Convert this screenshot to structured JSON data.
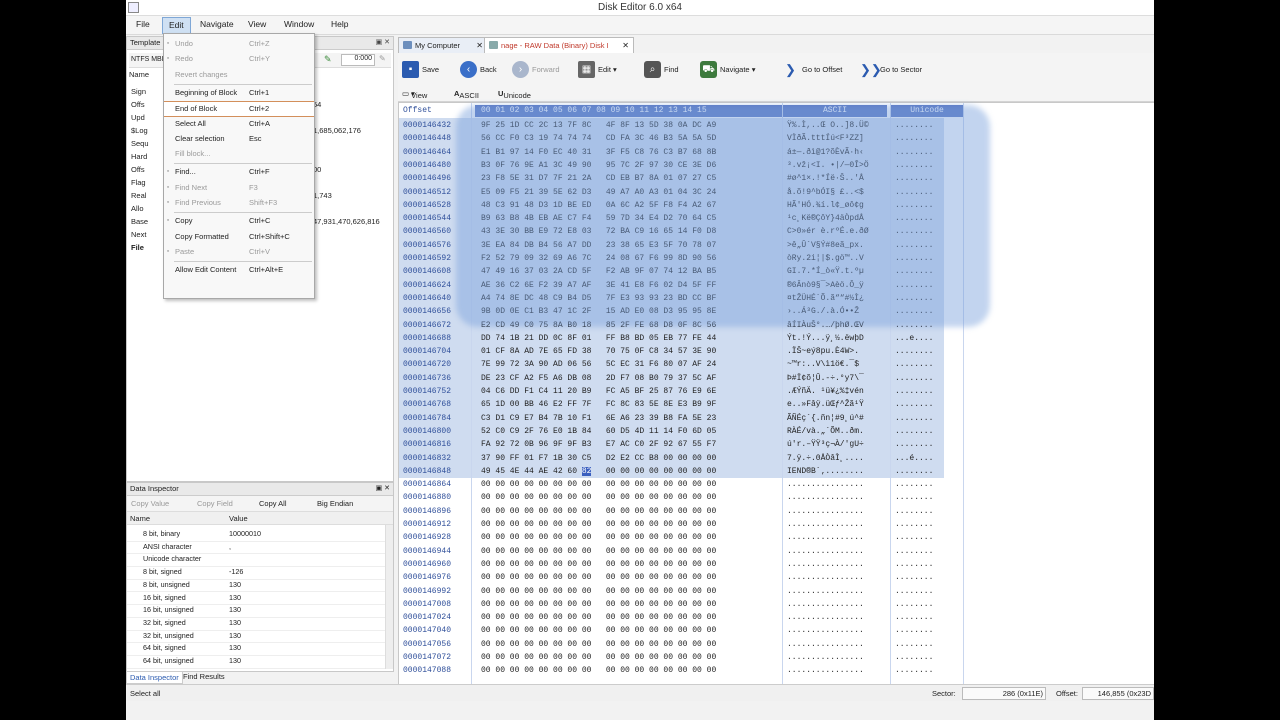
{
  "window": {
    "title": "Disk Editor 6.0 x64"
  },
  "menu": [
    "File",
    "Edit",
    "Navigate",
    "View",
    "Window",
    "Help"
  ],
  "template_panel": {
    "title": "Template",
    "selector": "NTFS MBR",
    "tool_value": "0:000",
    "column_header": "Name",
    "rows": [
      "Sign",
      "Offs",
      "Upd",
      "$Log",
      "Sequ",
      "Hard",
      "Offs",
      "Flag",
      "Real",
      "Allo",
      "Base",
      "Next",
      "File"
    ],
    "values": [
      "54",
      "1,685,062,176",
      "00",
      "1,743",
      "47,931,470,626,816"
    ]
  },
  "edit_menu": [
    {
      "label": "Undo",
      "shortcut": "Ctrl+Z",
      "disabled": true,
      "icon": "undo-icon"
    },
    {
      "label": "Redo",
      "shortcut": "Ctrl+Y",
      "disabled": true,
      "icon": "redo-icon"
    },
    {
      "label": "Revert changes",
      "shortcut": "",
      "disabled": true
    },
    {
      "sep": true
    },
    {
      "label": "Beginning of Block",
      "shortcut": "Ctrl+1",
      "disabled": false
    },
    {
      "label": "End of Block",
      "shortcut": "Ctrl+2",
      "disabled": false,
      "highlight": true
    },
    {
      "label": "Select All",
      "shortcut": "Ctrl+A",
      "disabled": false
    },
    {
      "label": "Clear selection",
      "shortcut": "Esc",
      "disabled": false
    },
    {
      "label": "Fill block...",
      "shortcut": "",
      "disabled": true
    },
    {
      "sep": true
    },
    {
      "label": "Find...",
      "shortcut": "Ctrl+F",
      "disabled": false,
      "icon": "find-icon"
    },
    {
      "label": "Find Next",
      "shortcut": "F3",
      "disabled": true,
      "icon": "find-next-icon"
    },
    {
      "label": "Find Previous",
      "shortcut": "Shift+F3",
      "disabled": true,
      "icon": "find-previous-icon"
    },
    {
      "sep": true
    },
    {
      "label": "Copy",
      "shortcut": "Ctrl+C",
      "disabled": false,
      "icon": "copy-icon"
    },
    {
      "label": "Copy Formatted",
      "shortcut": "Ctrl+Shift+C",
      "disabled": false
    },
    {
      "label": "Paste",
      "shortcut": "Ctrl+V",
      "disabled": true,
      "icon": "paste-icon"
    },
    {
      "sep": true
    },
    {
      "label": "Allow Edit Content",
      "shortcut": "Ctrl+Alt+E",
      "disabled": false
    }
  ],
  "tabs": [
    {
      "label": "My Computer",
      "active": false
    },
    {
      "label": "nage - RAW Data (Binary) Disk I",
      "active": true
    }
  ],
  "toolbar": [
    {
      "label": "Save",
      "icon": "save-icon",
      "color": "#2b5bb0",
      "disabled": false
    },
    {
      "label": "Back",
      "icon": "back-arrow-icon",
      "color": "#3a6fc8",
      "disabled": false
    },
    {
      "label": "Forward",
      "icon": "forward-arrow-icon",
      "color": "#a9b6cc",
      "disabled": true
    },
    {
      "label": "Edit",
      "icon": "edit-icon",
      "color": "#555555",
      "disabled": false
    },
    {
      "label": "Find",
      "icon": "find-binoculars-icon",
      "color": "#555555",
      "disabled": false
    },
    {
      "label": "Navigate",
      "icon": "navigate-icon",
      "color": "#3d7a3d",
      "disabled": false
    },
    {
      "label": "Go to Offset",
      "icon": "goto-offset-icon",
      "color": "#2b5bb0",
      "disabled": false
    },
    {
      "label": "Go to Sector",
      "icon": "goto-sector-icon",
      "color": "#2b5bb0",
      "disabled": false
    }
  ],
  "viewbar": {
    "view": "View",
    "ascii": "ASCII",
    "unicode": "Unicode"
  },
  "hex": {
    "header_offset": "Offset",
    "header_bytes": "00 01 02 03 04 05 06 07   08 09 10 11 12 13 14 15",
    "header_ascii": "ASCII",
    "header_unicode": "Unicode",
    "rows": [
      {
        "off": "0000146432",
        "b": "9F 25 1D CC 2C 13 7F 8C   4F 8F 13 5D 38 0A DC A9",
        "a": "Ÿ%.Ì,..Œ O..]8.Ü©",
        "u": "........"
      },
      {
        "off": "0000146448",
        "b": "56 CC F0 C3 19 74 74 74   CD FA 3C 46 B3 5A 5A 5D",
        "a": "VÌðÃ.tttÍú<F³ZZ]",
        "u": "........"
      },
      {
        "off": "0000146464",
        "b": "E1 B1 97 14 F0 EC 40 31   3F F5 C8 76 C3 B7 68 8B",
        "a": "á±—.ðì@1?õÈvÃ·h‹",
        "u": "........"
      },
      {
        "off": "0000146480",
        "b": "B3 0F 76 9E A1 3C 49 90   95 7C 2F 97 30 CE 3E D6",
        "a": "³.vž¡<I. •|/—0Î>Ö",
        "u": "........"
      },
      {
        "off": "0000146496",
        "b": "23 F8 5E 31 D7 7F 21 2A   CD EB B7 8A 01 07 27 C5",
        "a": "#ø^1×.!*Íë·Š..'Å",
        "u": "........"
      },
      {
        "off": "0000146512",
        "b": "E5 09 F5 21 39 5E 62 D3   49 A7 A0 A3 01 04 3C 24",
        "a": "å.õ!9^bÓI§ £..<$",
        "u": "........"
      },
      {
        "off": "0000146528",
        "b": "48 C3 91 48 D3 1D BE ED   0A 6C A2 5F F8 F4 A2 67",
        "a": "HÃ'HÓ.¾í.l¢_øô¢g",
        "u": "........"
      },
      {
        "off": "0000146544",
        "b": "B9 63 B8 4B EB AE C7 F4   59 7D 34 E4 D2 70 64 C5",
        "a": "¹c¸Kë®ÇôY}4äÒpdÅ",
        "u": "........"
      },
      {
        "off": "0000146560",
        "b": "43 3E 30 BB E9 72 E8 03   72 BA C9 16 65 14 F0 D8",
        "a": "C>0»ér è.rºÉ.e.ðØ",
        "u": "........"
      },
      {
        "off": "0000146576",
        "b": "3E EA 84 DB B4 56 A7 DD   23 38 65 E3 5F 70 78 07",
        "a": ">ê„Û´V§Ý#8eã_px.",
        "u": "........"
      },
      {
        "off": "0000146592",
        "b": "F2 52 79 09 32 69 A6 7C   24 08 67 F6 99 8D 90 56",
        "a": "òRy.2i¦|$.gö™..V",
        "u": "........"
      },
      {
        "off": "0000146608",
        "b": "47 49 16 37 03 2A CD 5F   F2 AB 9F 07 74 12 BA B5",
        "a": "GI.7.*Í_ò«Ÿ.t.ºµ",
        "u": "........"
      },
      {
        "off": "0000146624",
        "b": "AE 36 C2 6E F2 39 A7 AF   3E 41 E8 F6 02 D4 5F FF",
        "a": "®6Ânò9§¯>Aèö.Ô_ÿ",
        "u": "........"
      },
      {
        "off": "0000146640",
        "b": "A4 74 8E DC 48 C9 B4 D5   7F E3 93 93 23 BD CC BF",
        "a": "¤tŽÜHÉ´Õ.ã““#½Ì¿",
        "u": "........"
      },
      {
        "off": "0000146656",
        "b": "9B 0D 0E C1 B3 47 1C 2F   15 AD E0 08 D3 95 95 8E",
        "a": "›..Á³G./.­à.Ó••Ž",
        "u": "........"
      },
      {
        "off": "0000146672",
        "b": "E2 CD 49 C0 75 8A B0 18   85 2F FE 68 D8 0F 8C 56",
        "a": "âÍIÀuŠ°.…/þhØ.ŒV",
        "u": "........"
      },
      {
        "off": "0000146688",
        "b": "DD 74 1B 21 DD 0C 8F 01   FF B8 BD 05 EB 77 FE 44",
        "a": "Ýt.!Ý...ÿ¸½.ëwþD",
        "u": "...e...."
      },
      {
        "off": "0000146704",
        "b": "01 CF 8A AD 7E 65 FD 38   70 75 0F C8 34 57 3E 90",
        "a": ".ÏŠ­~eý8pu.È4W>.",
        "u": "........"
      },
      {
        "off": "0000146720",
        "b": "7E 99 72 3A 90 AD 06 56   5C EC 31 F6 80 07 AF 24",
        "a": "~™r:.­.V\\ì1ö€.¯$",
        "u": "........"
      },
      {
        "off": "0000146736",
        "b": "DE 23 CF A2 F5 A6 DB 08   2D F7 08 B0 79 37 5C AF",
        "a": "Þ#Ï¢õ¦Û.-÷.°y7\\¯",
        "u": "........"
      },
      {
        "off": "0000146752",
        "b": "04 C6 DD F1 C4 11 20 B9   FC A5 BF 25 87 76 E9 6E",
        "a": ".ÆÝñÄ. ¹ü¥¿%‡vén",
        "u": "........"
      },
      {
        "off": "0000146768",
        "b": "65 1D 00 BB 46 E2 FF 7F   FC 8C 83 5E 8E E3 B9 9F",
        "a": "e..»Fâÿ.üŒƒ^Žã¹Ÿ",
        "u": "........"
      },
      {
        "off": "0000146784",
        "b": "C3 D1 C9 E7 B4 7B 10 F1   6E A6 23 39 B8 FA 5E 23",
        "a": "ÃÑÉç´{.ñn¦#9¸ú^#",
        "u": "........"
      },
      {
        "off": "0000146800",
        "b": "52 C0 C9 2F 76 E0 1B 84   60 D5 4D 11 14 F0 6D 05",
        "a": "RÀÉ/và.„`ÕM..ðm.",
        "u": "........"
      },
      {
        "off": "0000146816",
        "b": "FA 92 72 0B 96 9F 9F B3   E7 AC C0 2F 92 67 55 F7",
        "a": "ú'r.–ŸŸ³ç¬À/'gU÷",
        "u": "........"
      },
      {
        "off": "0000146832",
        "b": "37 90 FF 01 F7 1B 30 C5   D2 E2 CC B8 00 00 00 00",
        "a": "7.ÿ.÷.0ÅÒâÌ¸....",
        "u": "...é...."
      },
      {
        "off": "0000146848",
        "b": "49 45 4E 44 AE 42 60 82   00 00 00 00 00 00 00 00",
        "a": "IEND®B`‚........",
        "u": "........"
      },
      {
        "off": "0000146864",
        "b": "00 00 00 00 00 00 00 00   00 00 00 00 00 00 00 00",
        "a": "................",
        "u": "........"
      },
      {
        "off": "0000146880",
        "b": "00 00 00 00 00 00 00 00   00 00 00 00 00 00 00 00",
        "a": "................",
        "u": "........"
      },
      {
        "off": "0000146896",
        "b": "00 00 00 00 00 00 00 00   00 00 00 00 00 00 00 00",
        "a": "................",
        "u": "........"
      },
      {
        "off": "0000146912",
        "b": "00 00 00 00 00 00 00 00   00 00 00 00 00 00 00 00",
        "a": "................",
        "u": "........"
      },
      {
        "off": "0000146928",
        "b": "00 00 00 00 00 00 00 00   00 00 00 00 00 00 00 00",
        "a": "................",
        "u": "........"
      },
      {
        "off": "0000146944",
        "b": "00 00 00 00 00 00 00 00   00 00 00 00 00 00 00 00",
        "a": "................",
        "u": "........"
      },
      {
        "off": "0000146960",
        "b": "00 00 00 00 00 00 00 00   00 00 00 00 00 00 00 00",
        "a": "................",
        "u": "........"
      },
      {
        "off": "0000146976",
        "b": "00 00 00 00 00 00 00 00   00 00 00 00 00 00 00 00",
        "a": "................",
        "u": "........"
      },
      {
        "off": "0000146992",
        "b": "00 00 00 00 00 00 00 00   00 00 00 00 00 00 00 00",
        "a": "................",
        "u": "........"
      },
      {
        "off": "0000147008",
        "b": "00 00 00 00 00 00 00 00   00 00 00 00 00 00 00 00",
        "a": "................",
        "u": "........"
      },
      {
        "off": "0000147024",
        "b": "00 00 00 00 00 00 00 00   00 00 00 00 00 00 00 00",
        "a": "................",
        "u": "........"
      },
      {
        "off": "0000147040",
        "b": "00 00 00 00 00 00 00 00   00 00 00 00 00 00 00 00",
        "a": "................",
        "u": "........"
      },
      {
        "off": "0000147056",
        "b": "00 00 00 00 00 00 00 00   00 00 00 00 00 00 00 00",
        "a": "................",
        "u": "........"
      },
      {
        "off": "0000147072",
        "b": "00 00 00 00 00 00 00 00   00 00 00 00 00 00 00 00",
        "a": "................",
        "u": "........"
      },
      {
        "off": "0000147088",
        "b": "00 00 00 00 00 00 00 00   00 00 00 00 00 00 00 00",
        "a": "................",
        "u": "........"
      }
    ],
    "cursor_byte": "82",
    "selection_color": "#cfdcf0",
    "header_color": "#5b79c4"
  },
  "data_inspector": {
    "title": "Data Inspector",
    "tools": [
      "Copy Value",
      "Copy Field",
      "Copy All",
      "Big Endian"
    ],
    "col_name": "Name",
    "col_value": "Value",
    "rows": [
      {
        "name": "8 bit, binary",
        "value": "10000010"
      },
      {
        "name": "ANSI character",
        "value": ","
      },
      {
        "name": "Unicode character",
        "value": ""
      },
      {
        "name": "8 bit, signed",
        "value": "-126"
      },
      {
        "name": "8 bit, unsigned",
        "value": "130"
      },
      {
        "name": "16 bit, signed",
        "value": "130"
      },
      {
        "name": "16 bit, unsigned",
        "value": "130"
      },
      {
        "name": "32 bit, signed",
        "value": "130"
      },
      {
        "name": "32 bit, unsigned",
        "value": "130"
      },
      {
        "name": "64 bit, signed",
        "value": "130"
      },
      {
        "name": "64 bit, unsigned",
        "value": "130"
      }
    ]
  },
  "bottom_tabs": [
    "Data Inspector",
    "Find Results"
  ],
  "status": {
    "left": "Select all",
    "sector_label": "Sector:",
    "sector_value": "286 (0x11E)",
    "offset_label": "Offset:",
    "offset_value": "146,855 (0x23D"
  }
}
